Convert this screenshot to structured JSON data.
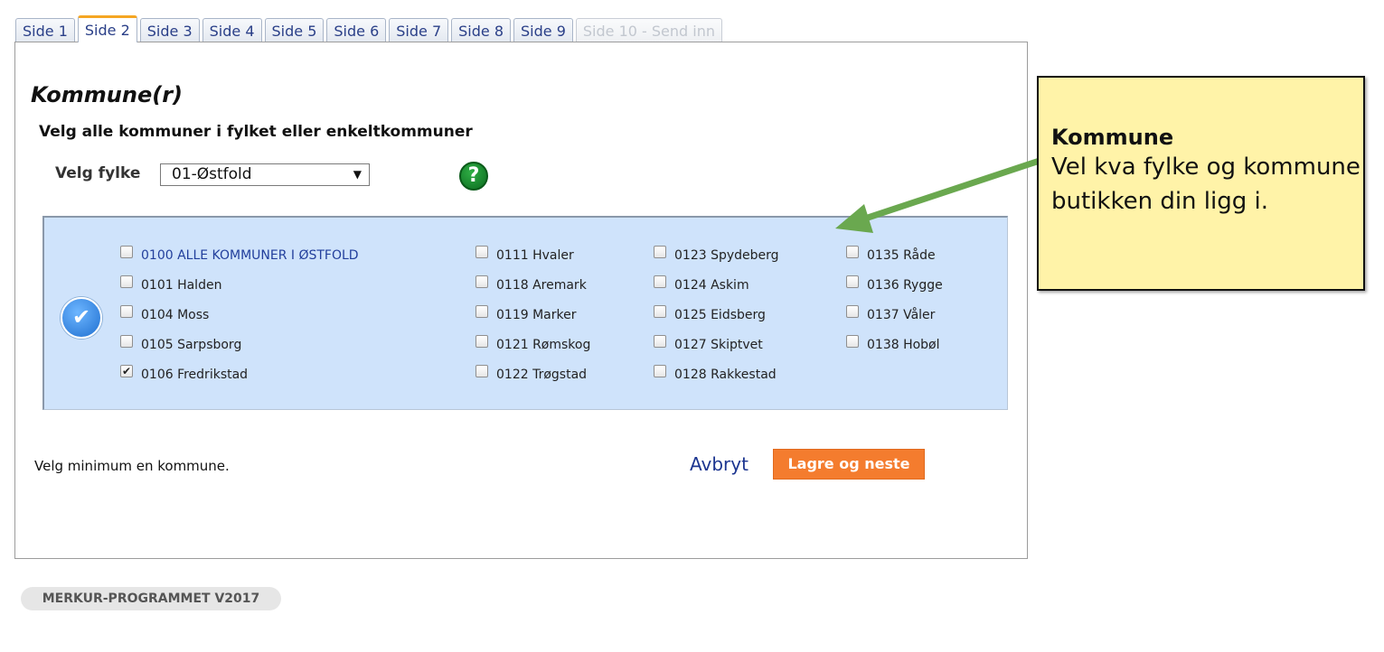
{
  "tabs": [
    {
      "label": "Side 1",
      "state": "normal"
    },
    {
      "label": "Side 2",
      "state": "active"
    },
    {
      "label": "Side 3",
      "state": "normal"
    },
    {
      "label": "Side 4",
      "state": "normal"
    },
    {
      "label": "Side 5",
      "state": "normal"
    },
    {
      "label": "Side 6",
      "state": "normal"
    },
    {
      "label": "Side 7",
      "state": "normal"
    },
    {
      "label": "Side 8",
      "state": "normal"
    },
    {
      "label": "Side 9",
      "state": "normal"
    },
    {
      "label": "Side 10 - Send inn",
      "state": "disabled"
    }
  ],
  "form": {
    "title": "Kommune(r)",
    "subtitle": "Velg alle kommuner i fylket eller enkeltkommuner",
    "fylke_label": "Velg fylke",
    "fylke_selected": "01-Østfold",
    "help_icon": "question-mark-icon",
    "help_symbol": "?",
    "bulk_icon_symbol": "✔",
    "kommuner": [
      [
        {
          "label": "0100 ALLE KOMMUNER I ØSTFOLD",
          "checked": false
        },
        {
          "label": "0101 Halden",
          "checked": false
        },
        {
          "label": "0104 Moss",
          "checked": false
        },
        {
          "label": "0105 Sarpsborg",
          "checked": false
        },
        {
          "label": "0106 Fredrikstad",
          "checked": true
        }
      ],
      [
        {
          "label": "0111 Hvaler",
          "checked": false
        },
        {
          "label": "0118 Aremark",
          "checked": false
        },
        {
          "label": "0119 Marker",
          "checked": false
        },
        {
          "label": "0121 Rømskog",
          "checked": false
        },
        {
          "label": "0122 Trøgstad",
          "checked": false
        }
      ],
      [
        {
          "label": "0123 Spydeberg",
          "checked": false
        },
        {
          "label": "0124 Askim",
          "checked": false
        },
        {
          "label": "0125 Eidsberg",
          "checked": false
        },
        {
          "label": "0127 Skiptvet",
          "checked": false
        },
        {
          "label": "0128 Rakkestad",
          "checked": false
        }
      ],
      [
        {
          "label": "0135 Råde",
          "checked": false
        },
        {
          "label": "0136 Rygge",
          "checked": false
        },
        {
          "label": "0137 Våler",
          "checked": false
        },
        {
          "label": "0138 Hobøl",
          "checked": false
        }
      ]
    ],
    "validation_message": "Velg minimum en kommune.",
    "cancel_label": "Avbryt",
    "save_label": "Lagre og neste"
  },
  "footer": {
    "badge": "MERKUR-PROGRAMMET V2017"
  },
  "note": {
    "title": "Kommune",
    "text": "Vel kva fylke og kommune butikken din ligg i."
  },
  "colors": {
    "accent_tab": "#f5a623",
    "box_bg": "#cfe3fb",
    "save_button": "#f47c2e",
    "note_bg": "#fff3a8",
    "arrow": "#6aa84f",
    "link": "#1c3590"
  }
}
